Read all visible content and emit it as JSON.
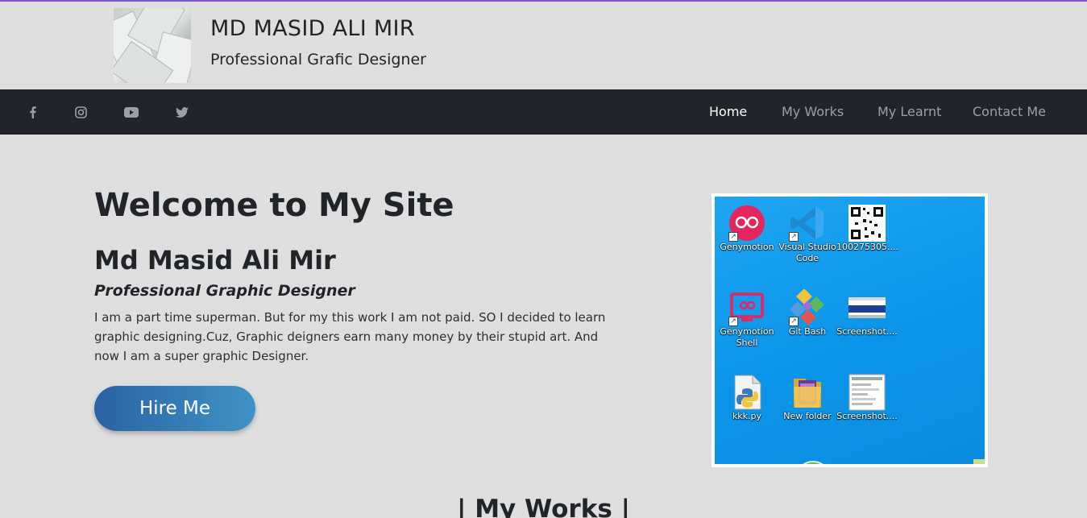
{
  "header": {
    "logo_icon": "paper-cards-logo",
    "name": "MD MASID ALI MIR",
    "tagline": "Professional Grafic Designer"
  },
  "navbar": {
    "social": [
      "facebook-icon",
      "instagram-icon",
      "youtube-icon",
      "twitter-icon"
    ],
    "links": [
      "Home",
      "My Works",
      "My Learnt",
      "Contact Me"
    ],
    "active": "Home"
  },
  "hero": {
    "welcome": "Welcome to My Site",
    "name": "Md Masid Ali Mir",
    "title": "Professional Graphic Designer",
    "description": "I am a part time superman. But for my this work I am not paid. SO I decided to learn graphic designing.Cuz, Graphic deigners earn many money by their stupid art. And now I am a super graphic Designer.",
    "button": "Hire Me"
  },
  "screenshot": {
    "icons": [
      {
        "label": "Genymotion",
        "icon": "genymotion-icon"
      },
      {
        "label": "Visual Studio Code",
        "icon": "vscode-icon"
      },
      {
        "label": "100275305....",
        "icon": "qr-code-icon"
      },
      {
        "label": "Genymotion Shell",
        "icon": "genymotion-shell-icon"
      },
      {
        "label": "Git Bash",
        "icon": "git-bash-icon"
      },
      {
        "label": "Screenshot....",
        "icon": "screenshot-file-icon"
      },
      {
        "label": "kkk.py",
        "icon": "python-file-icon"
      },
      {
        "label": "New folder",
        "icon": "folder-icon"
      },
      {
        "label": "Screenshot....",
        "icon": "screenshot-file-icon"
      }
    ]
  },
  "sections": {
    "works_heading": "| My Works |"
  },
  "colors": {
    "page_bg": "#dedede",
    "navbar_bg": "#212529",
    "nav_active": "#ffffff",
    "nav_inactive": "#9aa0a6",
    "button_gradient_start": "#2a62a4",
    "button_gradient_end": "#3f93c6",
    "top_border": "#7a56c2",
    "desktop_bg": "#0b95ea"
  }
}
